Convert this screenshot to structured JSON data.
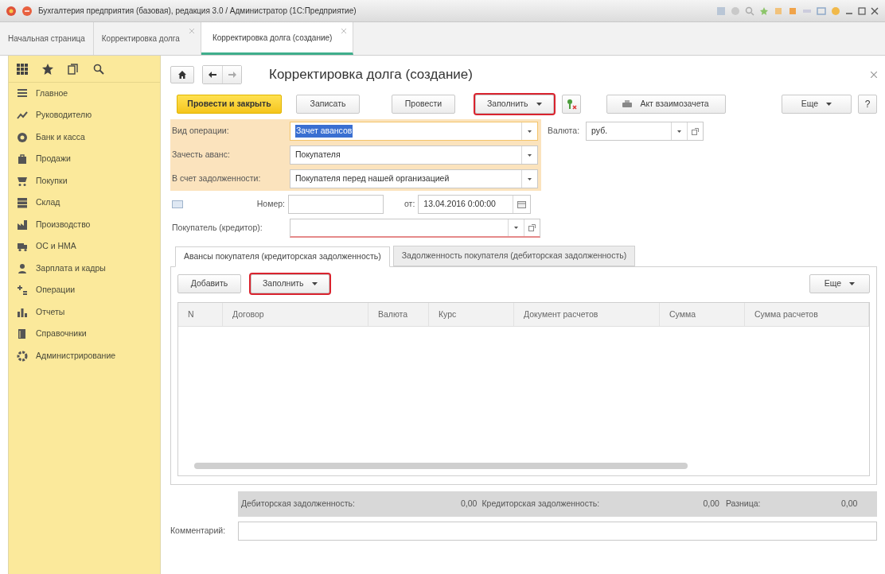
{
  "window": {
    "title": "Бухгалтерия предприятия (базовая), редакция 3.0 / Администратор (1С:Предприятие)"
  },
  "tabs": [
    {
      "label": "Начальная страница",
      "selected": false,
      "closable": false
    },
    {
      "label": "Корректировка долга",
      "selected": false,
      "closable": true
    },
    {
      "label": "Корректировка долга (создание)",
      "selected": true,
      "closable": true
    }
  ],
  "sidebar": {
    "items": [
      {
        "label": "Главное"
      },
      {
        "label": "Руководителю"
      },
      {
        "label": "Банк и касса"
      },
      {
        "label": "Продажи"
      },
      {
        "label": "Покупки"
      },
      {
        "label": "Склад"
      },
      {
        "label": "Производство"
      },
      {
        "label": "ОС и НМА"
      },
      {
        "label": "Зарплата и кадры"
      },
      {
        "label": "Операции"
      },
      {
        "label": "Отчеты"
      },
      {
        "label": "Справочники"
      },
      {
        "label": "Администрирование"
      }
    ]
  },
  "form": {
    "title": "Корректировка долга (создание)",
    "toolbar": [
      {
        "kind": "primary",
        "label": "Провести и закрыть",
        "highlighted": false
      },
      {
        "kind": "button",
        "label": "Записать",
        "highlighted": false
      },
      {
        "kind": "button",
        "label": "Провести",
        "highlighted": false
      },
      {
        "kind": "dropdown",
        "label": "Заполнить",
        "highlighted": true
      },
      {
        "kind": "icon",
        "highlighted": false
      },
      {
        "kind": "print",
        "label": "Акт взаимозачета",
        "highlighted": false
      },
      {
        "kind": "dropdown",
        "label": "Еще",
        "highlighted": false
      },
      {
        "kind": "help",
        "label": "?",
        "highlighted": false
      }
    ],
    "operation": {
      "label": "Вид операции:",
      "value": "Зачет авансов",
      "text_selected": true
    },
    "currency": {
      "label": "Валюта:",
      "value": "руб."
    },
    "advance": {
      "label": "Зачесть аванс:",
      "value": "Покупателя"
    },
    "debt": {
      "label": "В счет задолженности:",
      "value": "Покупателя перед нашей организацией"
    },
    "number": {
      "label": "Номер:"
    },
    "date": {
      "label": "от:",
      "value": "13.04.2016  0:00:00"
    },
    "buyer": {
      "label": "Покупатель (кредитор):",
      "required": true
    },
    "section_tabs": [
      {
        "label": "Авансы покупателя (кредиторская задолженность)",
        "selected": true
      },
      {
        "label": "Задолженность покупателя (дебиторская задолженность)",
        "selected": false
      }
    ],
    "table_toolbar": [
      {
        "kind": "button",
        "label": "Добавить",
        "highlighted": false
      },
      {
        "kind": "dropdown",
        "label": "Заполнить",
        "highlighted": true
      },
      {
        "kind": "more",
        "label": "Еще",
        "highlighted": false
      }
    ],
    "table": {
      "columns": [
        "N",
        "Договор",
        "Валюта",
        "Курс",
        "Документ расчетов",
        "Сумма",
        "Сумма расчетов"
      ]
    },
    "totals": [
      {
        "label": "Дебиторская задолженность:",
        "value": "0,00"
      },
      {
        "label": "Кредиторская задолженность:",
        "value": "0,00"
      },
      {
        "label": "Разница:",
        "value": "0,00"
      }
    ],
    "comment": {
      "label": "Комментарий:"
    }
  }
}
